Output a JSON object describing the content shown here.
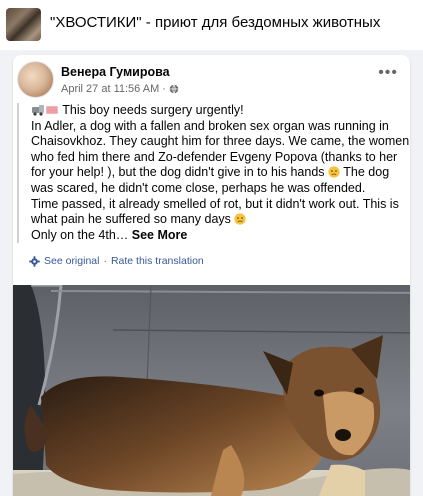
{
  "group": {
    "name": "\"ХВОСТИКИ\" - приют для бездомных животных"
  },
  "post": {
    "author": "Венера Гумирова",
    "date": "April 27 at 11:56 AM",
    "separator": "·",
    "more_icon": "•••",
    "lines": {
      "l1": "This boy needs surgery urgently!",
      "l2": "In Adler, a dog with a fallen and broken sex organ was running in",
      "l3": "Chaisovkhoz. They caught him for three days. We came, the women",
      "l4": "who fed him there and Zo-defender Evgeny Popova (thanks to her",
      "l5": "for your help! ), but the dog didn't give in to his hands",
      "l6": "The dog",
      "l7": "was scared, he didn't come close, perhaps he was offended.",
      "l8": "Time passed, it already smelled of rot, but it didn't work out. This is",
      "l9": "what pain he suffered so many days",
      "l10": "Only on the 4th…",
      "see_more": "See More"
    },
    "translation": {
      "see_original": "See original",
      "dot": "·",
      "rate": "Rate this translation"
    },
    "icons": {
      "line1_emoji": "ambulance-emoji",
      "line5_emoji": "sad-face-emoji",
      "line9_emoji": "sad-face-emoji",
      "privacy": "globe-icon",
      "translate": "gear-icon"
    },
    "colors": {
      "link": "#385898",
      "meta": "#65676b",
      "text": "#050505"
    }
  }
}
